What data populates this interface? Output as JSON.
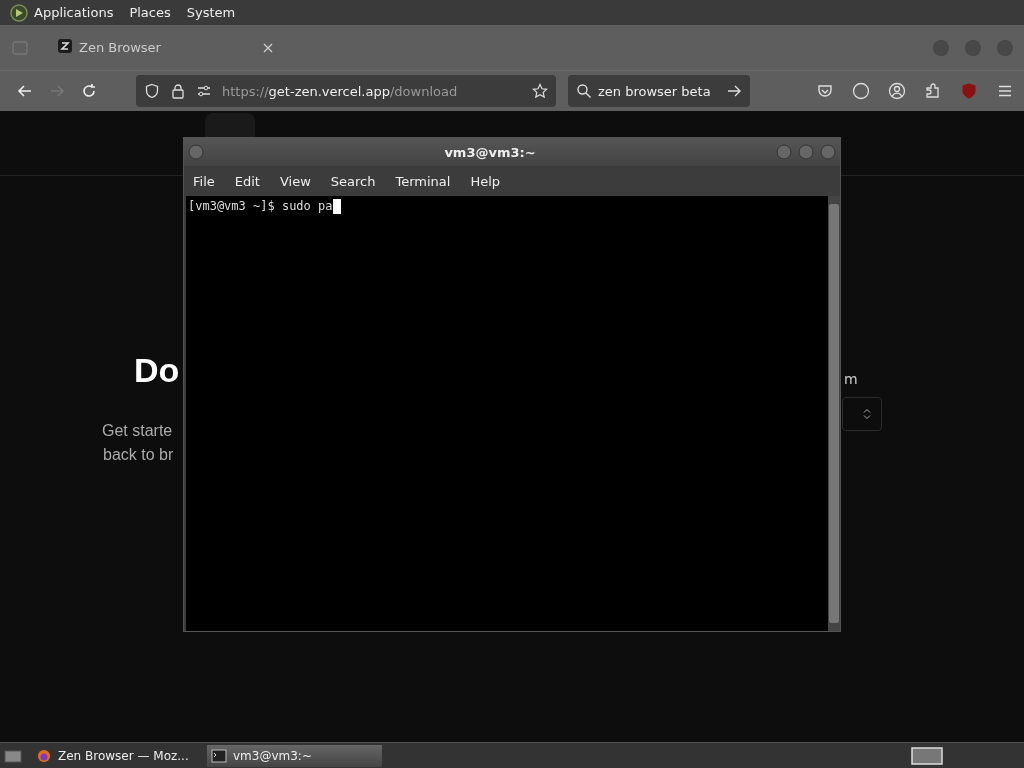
{
  "top_panel": {
    "menus": [
      "Applications",
      "Places",
      "System"
    ]
  },
  "browser": {
    "tab": {
      "title": "Zen Browser"
    },
    "url": {
      "scheme": "https://",
      "host": "get-zen.vercel.app",
      "path": "/download"
    },
    "search": {
      "value": "zen browser beta"
    }
  },
  "page": {
    "heading": "Do",
    "lines": [
      "Get starte",
      "back to br"
    ],
    "label": "m"
  },
  "terminal": {
    "title": "vm3@vm3:~",
    "menus": [
      "File",
      "Edit",
      "View",
      "Search",
      "Terminal",
      "Help"
    ],
    "prompt": "[vm3@vm3 ~]$ sudo pa"
  },
  "taskbar": {
    "tasks": [
      {
        "label": "Zen Browser — Moz...",
        "kind": "browser",
        "selected": false
      },
      {
        "label": "vm3@vm3:~",
        "kind": "terminal",
        "selected": true
      }
    ]
  }
}
